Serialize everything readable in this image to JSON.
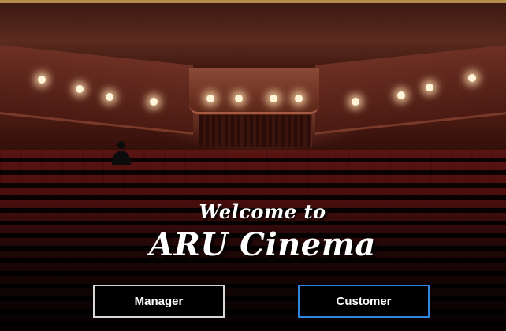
{
  "window": {
    "title_line1": "Welcome to",
    "title_line2": "ARU Cinema"
  },
  "buttons": {
    "manager_label": "Manager",
    "customer_label": "Customer"
  },
  "colors": {
    "focused_border": "#2f86e0",
    "button_border": "#d8d8d8",
    "button_background": "#000000",
    "text": "#ffffff"
  },
  "background": {
    "icon": "cinema-auditorium-photo"
  }
}
